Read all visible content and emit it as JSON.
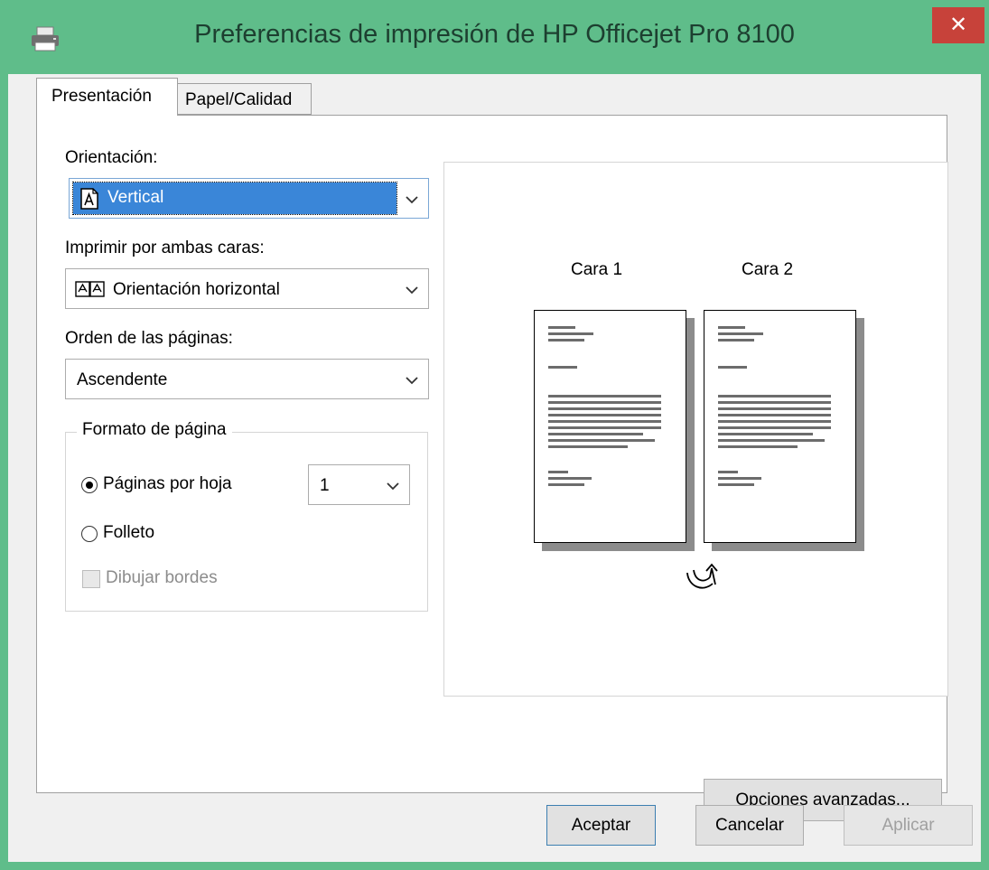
{
  "window": {
    "title": "Preferencias de impresión de HP Officejet Pro 8100",
    "close_glyph": "✕",
    "printer_icon": "printer-icon"
  },
  "tabs": [
    {
      "label": "Presentación",
      "active": true
    },
    {
      "label": "Papel/Calidad",
      "active": false
    }
  ],
  "orientation": {
    "label": "Orientación:",
    "value": "Vertical",
    "icon": "portrait-page-icon"
  },
  "duplex": {
    "label": "Imprimir por ambas caras:",
    "value": "Orientación horizontal",
    "icon": "flip-long-edge-icon"
  },
  "page_order": {
    "label": "Orden de las páginas:",
    "value": "Ascendente"
  },
  "page_format": {
    "title": "Formato de página",
    "pages_per_sheet_label": "Páginas por hoja",
    "pages_per_sheet_value": "1",
    "pages_per_sheet_selected": true,
    "booklet_label": "Folleto",
    "booklet_selected": false,
    "draw_borders_label": "Dibujar bordes",
    "draw_borders_enabled": false
  },
  "preview": {
    "side1_label": "Cara 1",
    "side2_label": "Cara 2",
    "flip_icon": "flip-arrow-icon"
  },
  "advanced_button": "Opciones avanzadas...",
  "buttons": {
    "ok": "Aceptar",
    "cancel": "Cancelar",
    "apply": "Aplicar"
  },
  "colors": {
    "title_bar": "#5fbd8a",
    "close_button": "#c7423a",
    "selection": "#3a86d8"
  }
}
